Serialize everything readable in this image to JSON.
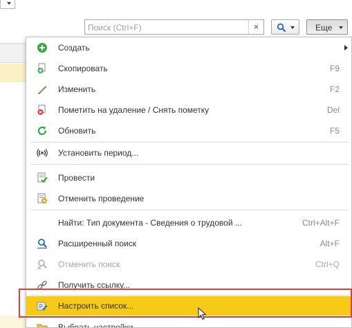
{
  "toolbar": {
    "search": {
      "placeholder": "Поиск (Ctrl+F)",
      "clear_glyph": "×"
    },
    "more_label": "Еще"
  },
  "menu": {
    "items": [
      {
        "label": "Создать",
        "shortcut": "",
        "icon": "create-icon",
        "submenu": true
      },
      {
        "label": "Скопировать",
        "shortcut": "F9",
        "icon": "copy-icon"
      },
      {
        "label": "Изменить",
        "shortcut": "F2",
        "icon": "edit-icon"
      },
      {
        "label": "Пометить на удаление / Снять пометку",
        "shortcut": "Del",
        "icon": "delete-mark-icon"
      },
      {
        "label": "Обновить",
        "shortcut": "F5",
        "icon": "refresh-icon"
      },
      {
        "label": "Установить период...",
        "shortcut": "",
        "icon": "period-icon"
      },
      {
        "label": "Провести",
        "shortcut": "",
        "icon": "post-icon"
      },
      {
        "label": "Отменить проведение",
        "shortcut": "",
        "icon": "unpost-icon"
      },
      {
        "label": "Найти: Тип документа - Сведения о трудовой ...",
        "shortcut": "Ctrl+Alt+F",
        "icon": ""
      },
      {
        "label": "Расширенный поиск",
        "shortcut": "Alt+F",
        "icon": "advanced-search-icon"
      },
      {
        "label": "Отменить поиск",
        "shortcut": "Ctrl+Q",
        "icon": "cancel-search-icon",
        "disabled": true
      },
      {
        "label": "Получить ссылку...",
        "shortcut": "",
        "icon": "link-icon"
      },
      {
        "label": "Настроить список...",
        "shortcut": "",
        "icon": "list-settings-icon",
        "highlighted": true
      },
      {
        "label": "Выбрать настройки...",
        "shortcut": "",
        "icon": "select-settings-icon"
      }
    ]
  },
  "colors": {
    "highlight": "#f7ca18",
    "annotation": "#e0403c"
  }
}
